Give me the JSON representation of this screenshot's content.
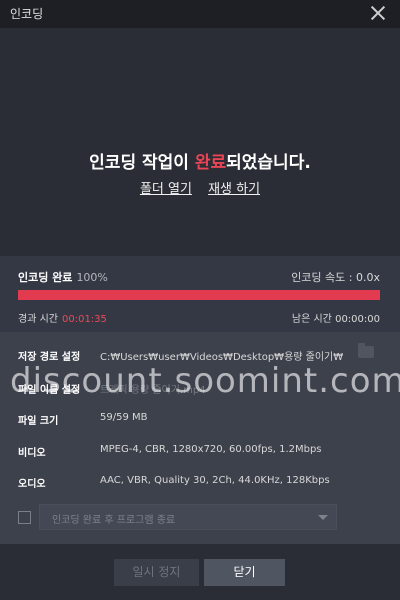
{
  "window": {
    "title": "인코딩"
  },
  "hero": {
    "message_before": "인코딩 작업이 ",
    "message_highlight": "완료",
    "message_after": "되었습니다.",
    "open_folder": "폴더 열기",
    "play": "재생 하기"
  },
  "progress": {
    "label": "인코딩 완료",
    "percent_text": "100%",
    "percent": 100,
    "speed_label": "인코딩 속도 : 0.0x",
    "elapsed_label": "경과 시간",
    "elapsed_value": "00:01:35",
    "remaining_label": "남은 시간",
    "remaining_value": "00:00:00"
  },
  "info": {
    "save_path_label": "저장 경로 설정",
    "save_path_value": "C:₩Users₩user₩Videos₩Desktop₩용량 줄이기₩",
    "file_name_label": "파일 이름 설정",
    "file_name_value": "트래픽 용량 줄이기.mp4",
    "file_size_label": "파일 크기",
    "file_size_value": "59/59 MB",
    "video_label": "비디오",
    "video_value": "MPEG-4, CBR, 1280x720, 60.00fps, 1.2Mbps",
    "audio_label": "오디오",
    "audio_value": "AAC, VBR, Quality 30, 2Ch, 44.0KHz, 128Kbps"
  },
  "after_action": {
    "checked": false,
    "placeholder": "인코딩 완료 후 프로그램 종료"
  },
  "buttons": {
    "pause": "일시 정지",
    "close": "닫기"
  },
  "watermark": "discount.soomint.com",
  "colors": {
    "accent": "#e23a4f",
    "background": "#2b2e36"
  },
  "icons": {
    "close": "close-icon",
    "folder": "folder-icon",
    "dropdown": "chevron-down-icon"
  }
}
